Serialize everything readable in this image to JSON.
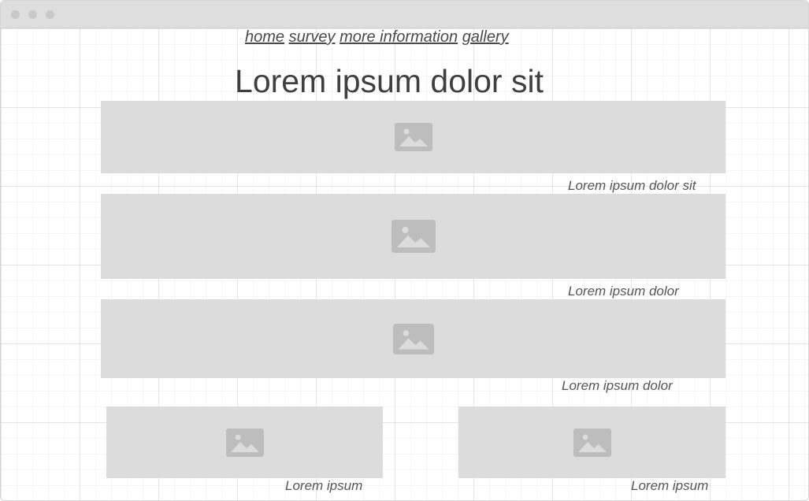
{
  "nav": {
    "links": [
      "home",
      "survey",
      "more information",
      "gallery"
    ]
  },
  "page": {
    "title": "Lorem ipsum dolor sit"
  },
  "captions": [
    "Lorem ipsum dolor sit",
    "Lorem ipsum dolor",
    "Lorem ipsum dolor",
    "Lorem ipsum",
    "Lorem ipsum"
  ],
  "icons": {
    "placeholder": "image-placeholder-icon"
  },
  "colors": {
    "placeholder_bg": "#dcdcdc",
    "placeholder_icon": "#bdbdbd",
    "text": "#4a4a4a"
  }
}
